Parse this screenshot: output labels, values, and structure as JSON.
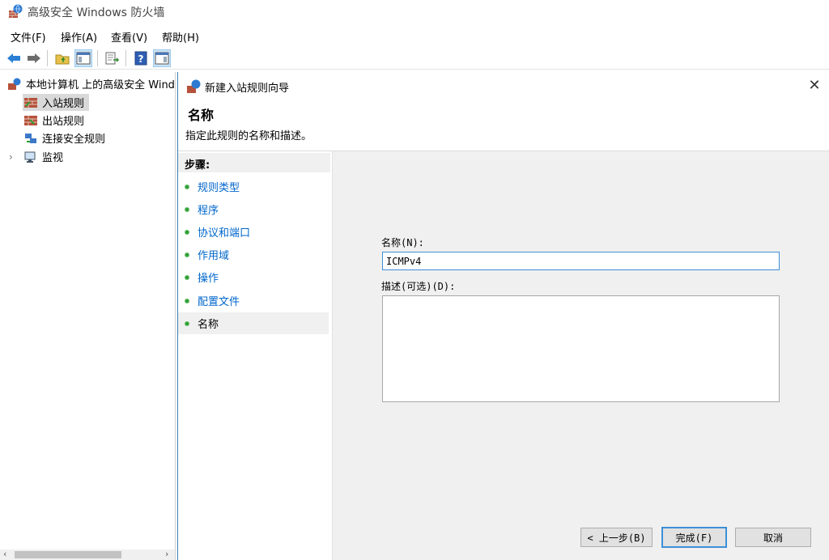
{
  "window": {
    "title": "高级安全 Windows 防火墙"
  },
  "menu": {
    "items": [
      "文件(F)",
      "操作(A)",
      "查看(V)",
      "帮助(H)"
    ]
  },
  "toolbar": {
    "icons": [
      "back-arrow-icon",
      "forward-arrow-icon",
      "up-folder-icon",
      "show-hide-tree-icon",
      "export-list-icon",
      "help-icon",
      "show-hide-action-pane-icon"
    ]
  },
  "tree": {
    "root": "本地计算机 上的高级安全 Windows",
    "items": [
      {
        "label": "入站规则",
        "selected": true
      },
      {
        "label": "出站规则"
      },
      {
        "label": "连接安全规则"
      },
      {
        "label": "监视"
      }
    ]
  },
  "wizard": {
    "title": "新建入站规则向导",
    "heading": "名称",
    "description": "指定此规则的名称和描述。",
    "steps_title": "步骤:",
    "steps": [
      "规则类型",
      "程序",
      "协议和端口",
      "作用域",
      "操作",
      "配置文件",
      "名称"
    ],
    "current_step": "名称",
    "name_label": "名称(N):",
    "name_value": "ICMPv4",
    "desc_label": "描述(可选)(D):",
    "desc_value": "",
    "buttons": {
      "back": "< 上一步(B)",
      "finish": "完成(F)",
      "cancel": "取消"
    }
  },
  "colors": {
    "accent": "#3d8fd8",
    "step_dot": "#2e9d33",
    "link": "#0066cc"
  }
}
